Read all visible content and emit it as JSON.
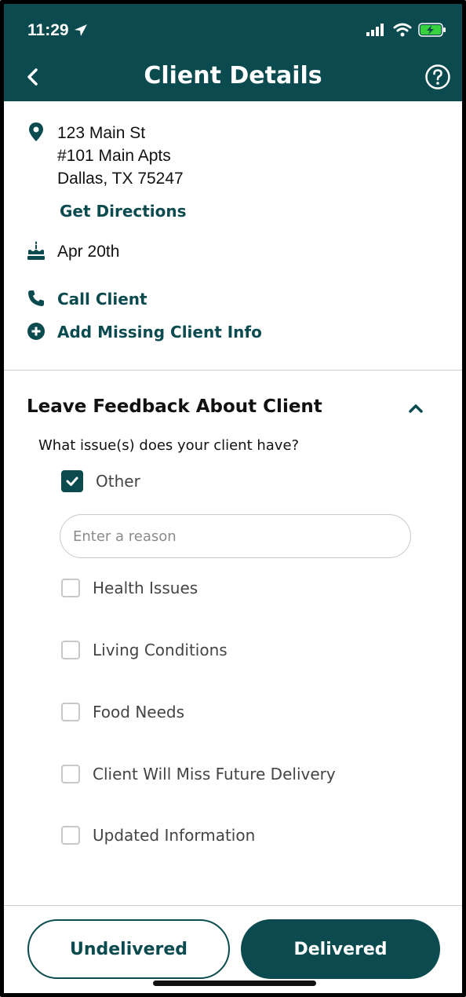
{
  "status_bar": {
    "time": "11:29"
  },
  "nav": {
    "title": "Client Details",
    "back_icon": "chevron-left-icon",
    "help_icon": "help-circle-icon"
  },
  "address": {
    "line1": "123 Main St",
    "line2": "#101 Main Apts",
    "line3": "Dallas, TX 75247",
    "directions_label": "Get Directions"
  },
  "birthday": {
    "date": "Apr 20th"
  },
  "actions": {
    "call_label": "Call Client",
    "add_info_label": "Add Missing Client Info"
  },
  "feedback": {
    "title": "Leave Feedback About Client",
    "question": "What issue(s) does your client have?",
    "options": [
      {
        "label": "Other",
        "checked": true
      },
      {
        "label": "Health Issues",
        "checked": false
      },
      {
        "label": "Living Conditions",
        "checked": false
      },
      {
        "label": "Food Needs",
        "checked": false
      },
      {
        "label": "Client Will Miss Future Delivery",
        "checked": false
      },
      {
        "label": "Updated Information",
        "checked": false
      }
    ],
    "reason_placeholder": "Enter a reason"
  },
  "footer": {
    "undelivered_label": "Undelivered",
    "delivered_label": "Delivered"
  },
  "colors": {
    "brand": "#0b4b4f",
    "text": "#111111",
    "muted": "#444444",
    "border": "#c8c8c8"
  }
}
